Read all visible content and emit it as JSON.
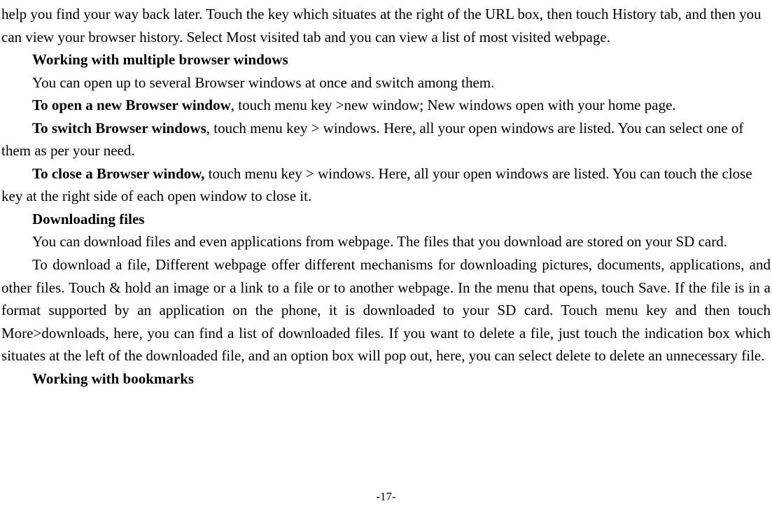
{
  "p1": "help you find your way back later. Touch the key which situates at the right of the URL box, then touch History tab, and then you can view your browser history. Select Most visited tab and you can view a list of most visited webpage.",
  "h1": "Working with multiple browser windows",
  "p2": "You can open up to several Browser windows at once and switch among them.",
  "p3a": "To open a new Browser window",
  "p3b": ", touch menu key >new window; New windows open with your home page.",
  "p4a": "To switch Browser windows",
  "p4b": ", touch menu key > windows. Here, all your open windows are listed. You can select one of them as per your need.",
  "p5a": "To close a Browser window, ",
  "p5b": "touch menu key > windows. Here, all your open windows are listed. You can touch the close key at the right side of each open window to close it.",
  "h2": "Downloading files",
  "p6": "You can download files and even applications from webpage. The files that you download are stored on your SD card.",
  "p7": "To download a file, Different webpage offer different mechanisms for downloading pictures, documents, applications, and other files. Touch & hold an image or a link to a file or to another webpage. In the menu that opens, touch Save. If the file is in a format supported by an application on the phone, it is downloaded to your SD card. Touch menu key and then touch More>downloads, here, you can find a list of downloaded files. If you want to delete a file, just touch the indication box which situates at the left of the downloaded file, and an option box will pop out, here, you can select delete to delete an unnecessary file.",
  "h3": "Working with bookmarks",
  "pageNumber": "-17-"
}
